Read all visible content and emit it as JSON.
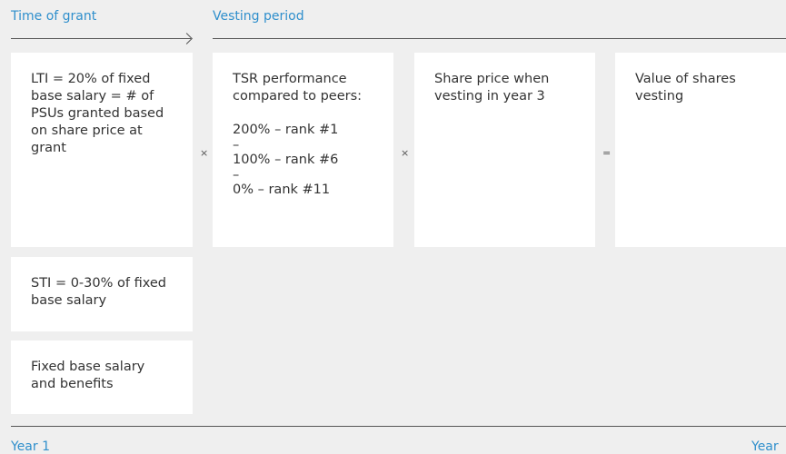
{
  "header": {
    "grant_label": "Time of grant",
    "vesting_label": "Vesting period"
  },
  "boxes": {
    "lti": "LTI = 20% of fixed base salary = # of PSUs granted based on share price at grant",
    "tsr": {
      "title": "TSR performance compared to peers:",
      "levels": [
        "200% – rank #1",
        "100% – rank #6",
        "0% – rank #11"
      ],
      "separator": "–"
    },
    "share_price": "Share price when vesting in year 3",
    "value": "Value of shares vesting",
    "sti": "STI = 0-30% of fixed base salary",
    "fixed": "Fixed base salary and benefits"
  },
  "operators": {
    "multiply_1": "×",
    "multiply_2": "×",
    "equals": "="
  },
  "footer": {
    "start_label": "Year 1",
    "end_label": "Year"
  },
  "colors": {
    "accent": "#2f8fcc",
    "background": "#efefef",
    "box": "#ffffff",
    "text": "#333333",
    "line": "#555555"
  }
}
